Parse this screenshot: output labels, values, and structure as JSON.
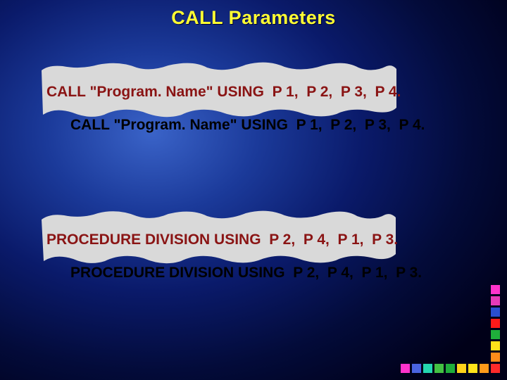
{
  "title": "CALL Parameters",
  "code_line_1": "CALL \"Program. Name\" USING  P 1,  P 2,  P 3,  P 4.",
  "code_line_2": "PROCEDURE DIVISION USING  P 2,  P 4,  P 1,  P 3.",
  "square_colors": {
    "magenta": "#ff33cc",
    "magenta2": "#e63ab8",
    "blue": "#2a4ed0",
    "red": "#ff1a1a",
    "green": "#1fae3b",
    "yellow": "#ffe21a",
    "orange": "#ff8c1a",
    "red2": "#ff2a2a",
    "cyan": "#24d6b0",
    "green2": "#43c143",
    "blue2": "#4a64e0",
    "yellow2": "#ffd21a",
    "orange2": "#ff9a1a"
  }
}
